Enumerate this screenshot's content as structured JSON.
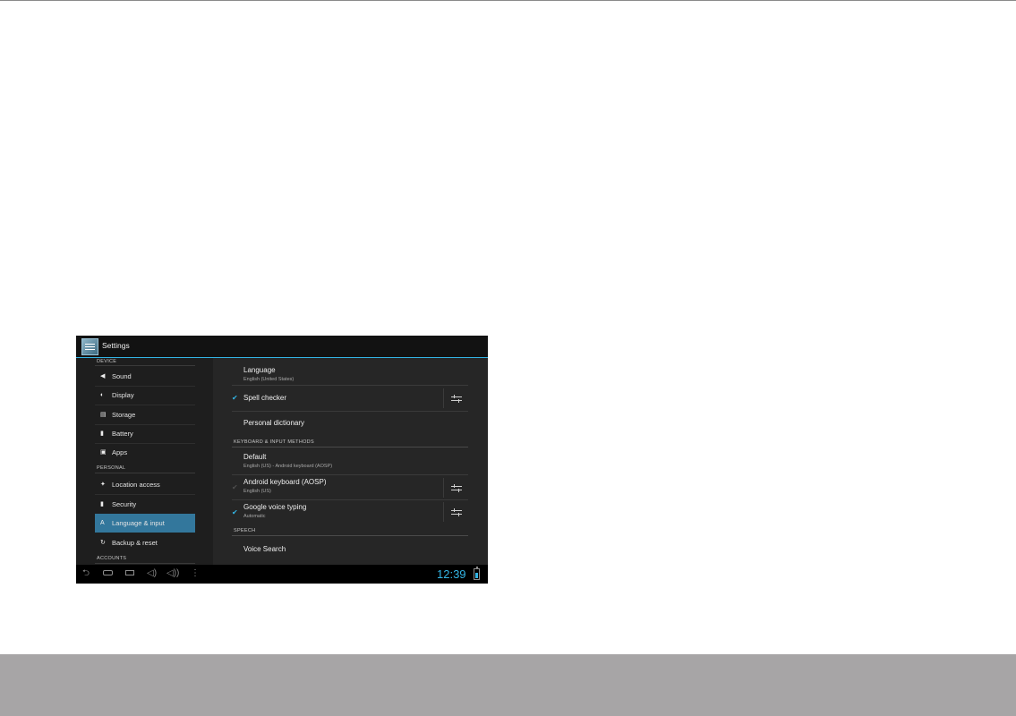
{
  "app": {
    "title": "Settings"
  },
  "sidebar": {
    "sections": [
      {
        "header": "DEVICE",
        "items": [
          {
            "label": "Sound",
            "icon": "speaker-icon"
          },
          {
            "label": "Display",
            "icon": "display-icon"
          },
          {
            "label": "Storage",
            "icon": "storage-icon"
          },
          {
            "label": "Battery",
            "icon": "battery-icon"
          },
          {
            "label": "Apps",
            "icon": "apps-icon"
          }
        ]
      },
      {
        "header": "PERSONAL",
        "items": [
          {
            "label": "Location access",
            "icon": "location-icon"
          },
          {
            "label": "Security",
            "icon": "lock-icon"
          },
          {
            "label": "Language & input",
            "icon": "language-icon",
            "selected": true
          },
          {
            "label": "Backup & reset",
            "icon": "backup-icon"
          }
        ]
      },
      {
        "header": "ACCOUNTS",
        "items": []
      }
    ]
  },
  "content": {
    "language": {
      "title": "Language",
      "summary": "English (United States)"
    },
    "spell_checker": {
      "title": "Spell checker",
      "checked": true
    },
    "personal_dictionary": {
      "title": "Personal dictionary"
    },
    "keyboard_header": "KEYBOARD & INPUT METHODS",
    "default": {
      "title": "Default",
      "summary": "English (US) - Android keyboard (AOSP)"
    },
    "android_keyboard": {
      "title": "Android keyboard (AOSP)",
      "summary": "English (US)",
      "checked": true,
      "enabled": false
    },
    "google_voice": {
      "title": "Google voice typing",
      "summary": "Automatic",
      "checked": true
    },
    "speech_header": "SPEECH",
    "voice_search": {
      "title": "Voice Search"
    }
  },
  "navbar": {
    "icons": [
      "back-icon",
      "home-icon",
      "recents-icon",
      "volume-down-icon",
      "volume-up-icon",
      "menu-icon"
    ],
    "clock": "12:39",
    "accent": "#33b5e5"
  }
}
